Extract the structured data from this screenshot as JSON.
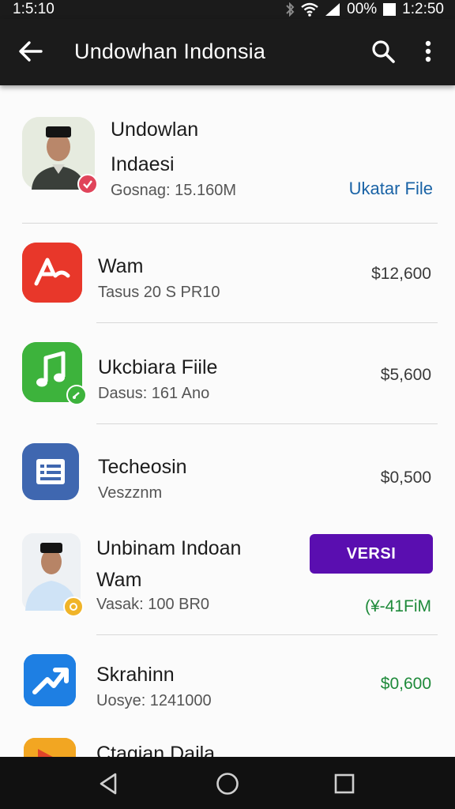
{
  "status_bar": {
    "time": "1:5:10",
    "battery": "00%",
    "clock_right": "1:2:50",
    "icons": [
      "bluetooth-icon",
      "wifi-icon",
      "signal-icon",
      "battery-icon"
    ]
  },
  "app_bar": {
    "title": "Undowhan Indonsia",
    "icons": [
      "back-arrow-icon",
      "search-icon",
      "more-vert-icon"
    ]
  },
  "items": [
    {
      "name_line1": "Undowlan",
      "name_line2": "Indaesi",
      "subtitle": "Gosnag: 15.160M",
      "action_link": "Ukatar File",
      "icon": "person-photo",
      "badge": "verified-badge-icon",
      "badge_color": "#e0445a"
    },
    {
      "name": "Wam",
      "subtitle": "Tasus 20 S PR10",
      "price": "$12,600",
      "icon": "red-app-icon",
      "icon_color": "#e8372a"
    },
    {
      "name": "Ukcbiara Fiile",
      "subtitle": "Dasus: 161 Ano",
      "price": "$5,600",
      "icon": "music-note-icon",
      "icon_color": "#3db33c",
      "badge": "green-badge-icon"
    },
    {
      "name": "Techeosin",
      "subtitle": "Veszznm",
      "price": "$0,500",
      "icon": "document-list-icon",
      "icon_color": "#3f67b0"
    },
    {
      "name_line1": "Unbinam Indoan",
      "name_line2": "Wam",
      "subtitle": "Vasak: 100 BR0",
      "button_label": "VERSI",
      "price": "(¥-41FiM",
      "icon": "person-photo",
      "badge": "gold-badge-icon",
      "badge_color": "#f0b429"
    },
    {
      "name": "Skrahinn",
      "subtitle": "Uosye: 1241000",
      "price": "$0,600",
      "icon": "trending-arrow-icon",
      "icon_color": "#1e7fe3"
    },
    {
      "name": "Ctagian Daila",
      "icon": "orange-app-icon",
      "icon_color": "#f2a622"
    }
  ],
  "nav_bar": {
    "icons": [
      "nav-back-icon",
      "nav-home-icon",
      "nav-recents-icon"
    ]
  },
  "colors": {
    "app_bar": "#1b1b1b",
    "accent_link": "#1a63a6",
    "button": "#5a0eb0",
    "price_green": "#1e8a3a"
  }
}
